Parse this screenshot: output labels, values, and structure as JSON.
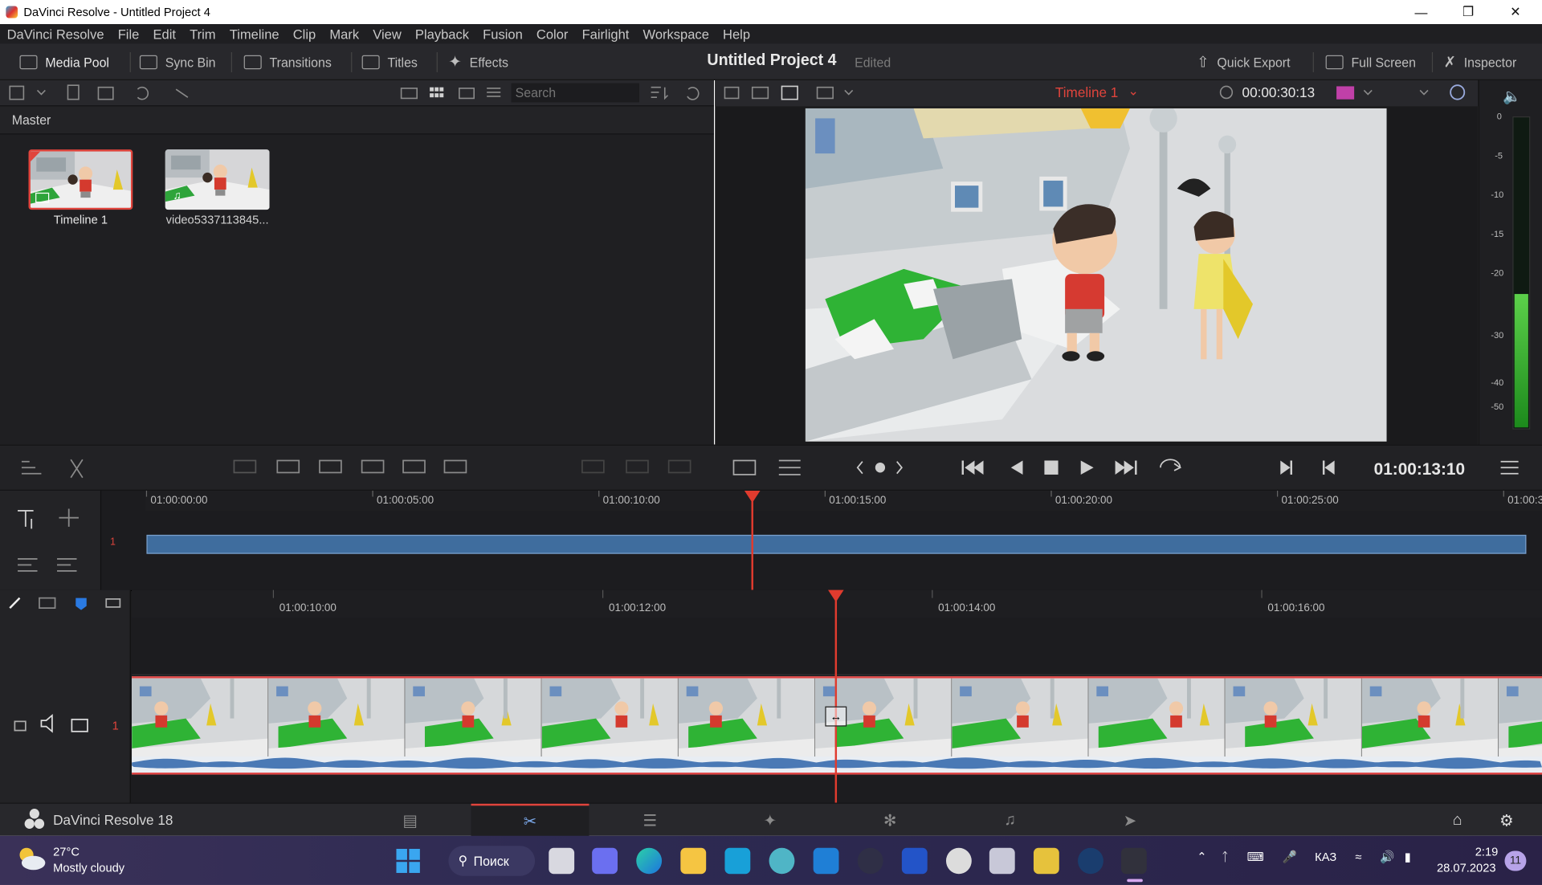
{
  "window": {
    "title": "DaVinci Resolve - Untitled Project 4"
  },
  "menu": [
    "DaVinci Resolve",
    "File",
    "Edit",
    "Trim",
    "Timeline",
    "Clip",
    "Mark",
    "View",
    "Playback",
    "Fusion",
    "Color",
    "Fairlight",
    "Workspace",
    "Help"
  ],
  "toolbar": {
    "media_pool": "Media Pool",
    "sync_bin": "Sync Bin",
    "transitions": "Transitions",
    "titles": "Titles",
    "effects": "Effects",
    "project_title": "Untitled Project 4",
    "status": "Edited",
    "quick_export": "Quick Export",
    "full_screen": "Full Screen",
    "inspector": "Inspector"
  },
  "media_pool": {
    "search_placeholder": "Search",
    "bin": "Master",
    "clips": [
      {
        "label": "Timeline 1",
        "selected": true
      },
      {
        "label": "video5337113845..."
      }
    ]
  },
  "viewer": {
    "timeline_name": "Timeline 1",
    "duration": "00:00:30:13",
    "timecode": "01:00:13:10"
  },
  "audio_meter": {
    "scale": [
      "0",
      "-5",
      "-10",
      "-15",
      "-20",
      "-30",
      "-40",
      "-50"
    ],
    "level_fraction": 0.42
  },
  "upper_timeline": {
    "ruler": [
      "01:00:00:00",
      "01:00:05:00",
      "01:00:10:00",
      "01:00:15:00",
      "01:00:20:00",
      "01:00:25:00",
      "01:00:3"
    ],
    "track_number": "1"
  },
  "lower_timeline": {
    "ruler": [
      "01:00:10:00",
      "01:00:12:00",
      "01:00:14:00",
      "01:00:16:00"
    ],
    "track_number": "1"
  },
  "pagebar": {
    "brand": "DaVinci Resolve 18",
    "active_page": "cut"
  },
  "taskbar": {
    "weather_temp": "27°C",
    "weather_desc": "Mostly cloudy",
    "search": "Поиск",
    "lang": "КАЗ",
    "time": "2:19",
    "date": "28.07.2023",
    "notifications": "11"
  },
  "colors": {
    "accent_red": "#e03b2e",
    "track_blue": "#3f6d9e",
    "bg_dark": "#1c1c1f"
  }
}
